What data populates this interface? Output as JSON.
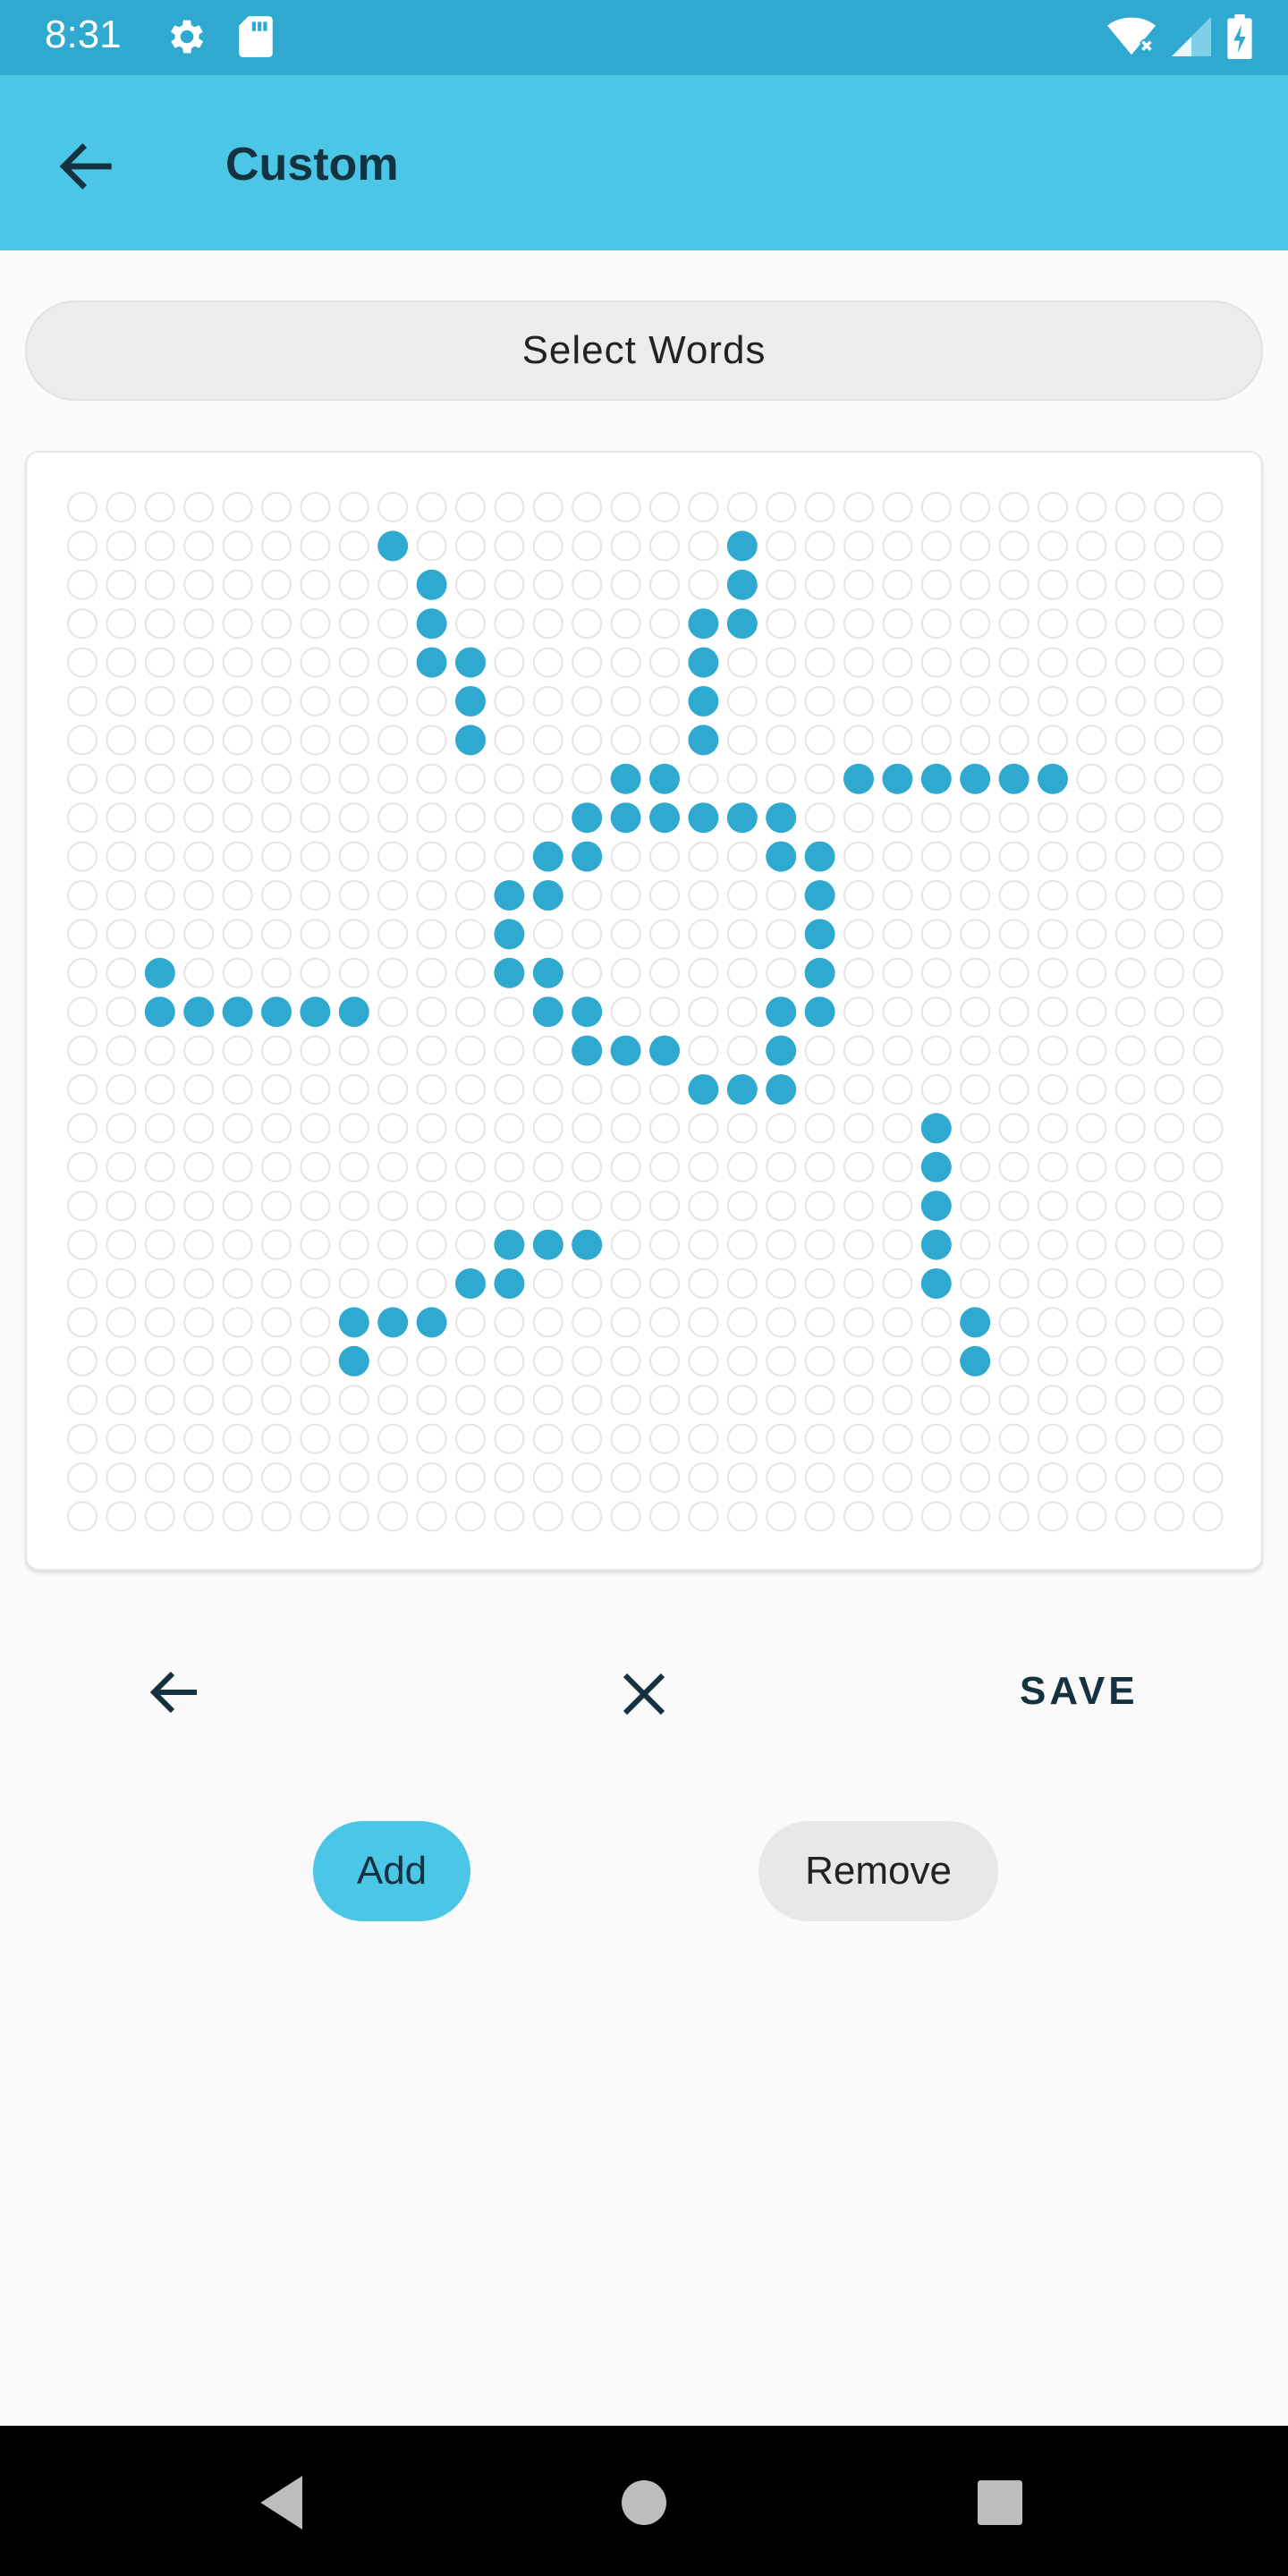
{
  "status_bar": {
    "time": "8:31",
    "left_icons": [
      "gear-icon",
      "sd-card-icon"
    ],
    "right_icons": [
      "wifi-icon",
      "signal-icon",
      "battery-charging-icon"
    ]
  },
  "app_bar": {
    "title": "Custom",
    "back_icon": "arrow-left-icon"
  },
  "select_words": {
    "label": "Select Words"
  },
  "grid": {
    "columns": 30,
    "rows": 27,
    "active_color": "#2fa9cf",
    "inactive_color": "#e4e4e4",
    "active_cells": [
      [
        1,
        8
      ],
      [
        1,
        17
      ],
      [
        2,
        9
      ],
      [
        2,
        17
      ],
      [
        3,
        9
      ],
      [
        3,
        16
      ],
      [
        3,
        17
      ],
      [
        4,
        9
      ],
      [
        4,
        10
      ],
      [
        4,
        16
      ],
      [
        5,
        10
      ],
      [
        5,
        16
      ],
      [
        6,
        10
      ],
      [
        6,
        16
      ],
      [
        7,
        14
      ],
      [
        7,
        15
      ],
      [
        7,
        20
      ],
      [
        7,
        21
      ],
      [
        7,
        22
      ],
      [
        7,
        23
      ],
      [
        7,
        24
      ],
      [
        7,
        25
      ],
      [
        8,
        13
      ],
      [
        8,
        14
      ],
      [
        8,
        15
      ],
      [
        8,
        16
      ],
      [
        8,
        17
      ],
      [
        8,
        18
      ],
      [
        9,
        12
      ],
      [
        9,
        13
      ],
      [
        9,
        18
      ],
      [
        9,
        19
      ],
      [
        10,
        11
      ],
      [
        10,
        12
      ],
      [
        10,
        19
      ],
      [
        11,
        11
      ],
      [
        11,
        19
      ],
      [
        12,
        2
      ],
      [
        12,
        11
      ],
      [
        12,
        12
      ],
      [
        12,
        19
      ],
      [
        13,
        2
      ],
      [
        13,
        3
      ],
      [
        13,
        4
      ],
      [
        13,
        5
      ],
      [
        13,
        6
      ],
      [
        13,
        7
      ],
      [
        13,
        12
      ],
      [
        13,
        13
      ],
      [
        13,
        18
      ],
      [
        13,
        19
      ],
      [
        14,
        13
      ],
      [
        14,
        14
      ],
      [
        14,
        15
      ],
      [
        14,
        18
      ],
      [
        15,
        16
      ],
      [
        15,
        17
      ],
      [
        15,
        18
      ],
      [
        16,
        22
      ],
      [
        17,
        22
      ],
      [
        18,
        22
      ],
      [
        19,
        11
      ],
      [
        19,
        12
      ],
      [
        19,
        13
      ],
      [
        19,
        22
      ],
      [
        20,
        10
      ],
      [
        20,
        11
      ],
      [
        20,
        22
      ],
      [
        21,
        7
      ],
      [
        21,
        8
      ],
      [
        21,
        9
      ],
      [
        21,
        23
      ],
      [
        22,
        7
      ],
      [
        22,
        23
      ]
    ]
  },
  "controls": {
    "back_icon": "arrow-left-icon",
    "clear_icon": "close-icon",
    "save_label": "SAVE"
  },
  "actions": {
    "add_label": "Add",
    "remove_label": "Remove",
    "add_color": "#4bc6e6"
  },
  "nav_bar": {
    "icons": [
      "back-triangle-icon",
      "home-circle-icon",
      "recents-square-icon"
    ]
  }
}
